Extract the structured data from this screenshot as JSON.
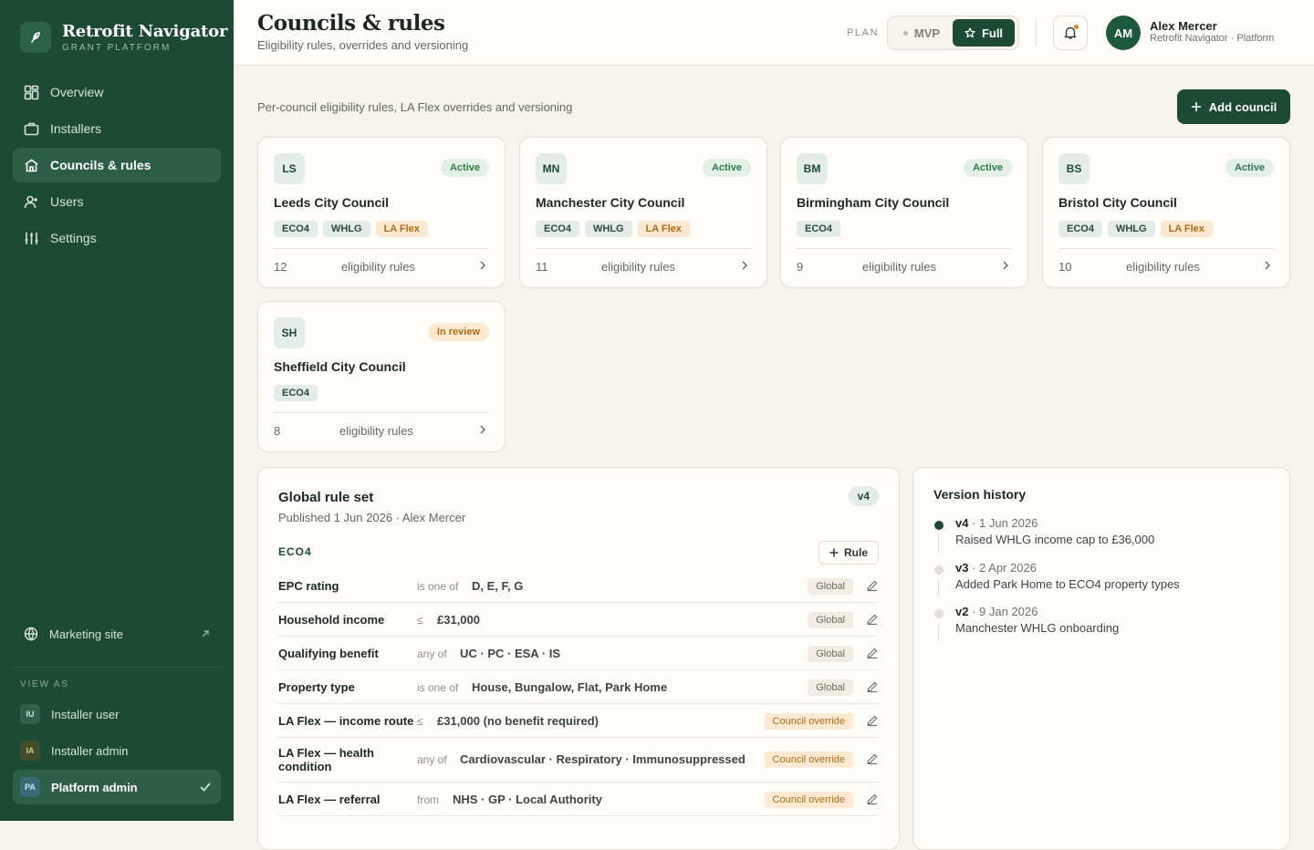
{
  "brand": {
    "title": "Retrofit Navigator",
    "subtitle": "GRANT PLATFORM"
  },
  "sidebar": {
    "items": [
      {
        "label": "Overview",
        "icon": "grid-icon"
      },
      {
        "label": "Installers",
        "icon": "briefcase-icon"
      },
      {
        "label": "Councils & rules",
        "icon": "building-icon",
        "active": true
      },
      {
        "label": "Users",
        "icon": "user-plus-icon"
      },
      {
        "label": "Settings",
        "icon": "sliders-icon"
      }
    ],
    "marketing": "Marketing site",
    "view_as_label": "VIEW AS",
    "personas": [
      {
        "initials": "IU",
        "label": "Installer user"
      },
      {
        "initials": "IA",
        "label": "Installer admin"
      },
      {
        "initials": "PA",
        "label": "Platform admin",
        "active": true
      }
    ]
  },
  "header": {
    "title": "Councils & rules",
    "subtitle": "Eligibility rules, overrides and versioning",
    "plan_label": "PLAN",
    "plan_options": [
      "MVP",
      "Full"
    ],
    "plan_selected": "Full",
    "user_initials": "AM",
    "user_name": "Alex Mercer",
    "user_role": "Retrofit Navigator · Platform"
  },
  "main": {
    "intro": "Per-council eligibility rules, LA Flex overrides and versioning",
    "add_council": "Add council",
    "rules_label": "eligibility rules",
    "councils": [
      {
        "initials": "LS",
        "name": "Leeds City Council",
        "status": "Active",
        "tags": [
          "ECO4",
          "WHLG",
          "LA Flex"
        ],
        "count": "12"
      },
      {
        "initials": "MN",
        "name": "Manchester City Council",
        "status": "Active",
        "tags": [
          "ECO4",
          "WHLG",
          "LA Flex"
        ],
        "count": "11"
      },
      {
        "initials": "BM",
        "name": "Birmingham City Council",
        "status": "Active",
        "tags": [
          "ECO4"
        ],
        "count": "9"
      },
      {
        "initials": "BS",
        "name": "Bristol City Council",
        "status": "Active",
        "tags": [
          "ECO4",
          "WHLG",
          "LA Flex"
        ],
        "count": "10"
      },
      {
        "initials": "SH",
        "name": "Sheffield City Council",
        "status": "In review",
        "tags": [
          "ECO4"
        ],
        "count": "8"
      }
    ]
  },
  "global_rules": {
    "title": "Global rule set",
    "published": "Published 1 Jun 2026 · Alex Mercer",
    "version": "v4",
    "section": "ECO4",
    "add_rule": "Rule",
    "rows": [
      {
        "name": "EPC rating",
        "op": "is one of",
        "value": "D, E, F, G",
        "scope": "Global"
      },
      {
        "name": "Household income",
        "op": "≤",
        "value": "£31,000",
        "scope": "Global"
      },
      {
        "name": "Qualifying benefit",
        "op": "any of",
        "value": "UC · PC · ESA · IS",
        "scope": "Global"
      },
      {
        "name": "Property type",
        "op": "is one of",
        "value": "House, Bungalow, Flat, Park Home",
        "scope": "Global"
      },
      {
        "name": "LA Flex — income route",
        "op": "≤",
        "value": "£31,000 (no benefit required)",
        "scope": "Council override"
      },
      {
        "name": "LA Flex — health condition",
        "op": "any of",
        "value": "Cardiovascular · Respiratory · Immunosuppressed",
        "scope": "Council override"
      },
      {
        "name": "LA Flex — referral",
        "op": "from",
        "value": "NHS · GP · Local Authority",
        "scope": "Council override"
      }
    ]
  },
  "version_history": {
    "title": "Version history",
    "items": [
      {
        "version": "v4",
        "date": " · 1 Jun 2026",
        "desc": "Raised WHLG income cap to £36,000",
        "current": true
      },
      {
        "version": "v3",
        "date": " · 2 Apr 2026",
        "desc": "Added Park Home to ECO4 property types"
      },
      {
        "version": "v2",
        "date": " · 9 Jan 2026",
        "desc": "Manchester WHLG onboarding"
      }
    ]
  },
  "colors": {
    "sidebar": "#1d4a33",
    "accent": "#1d4a33",
    "override": "#b06b14",
    "active_status": "#2f7a4b"
  }
}
